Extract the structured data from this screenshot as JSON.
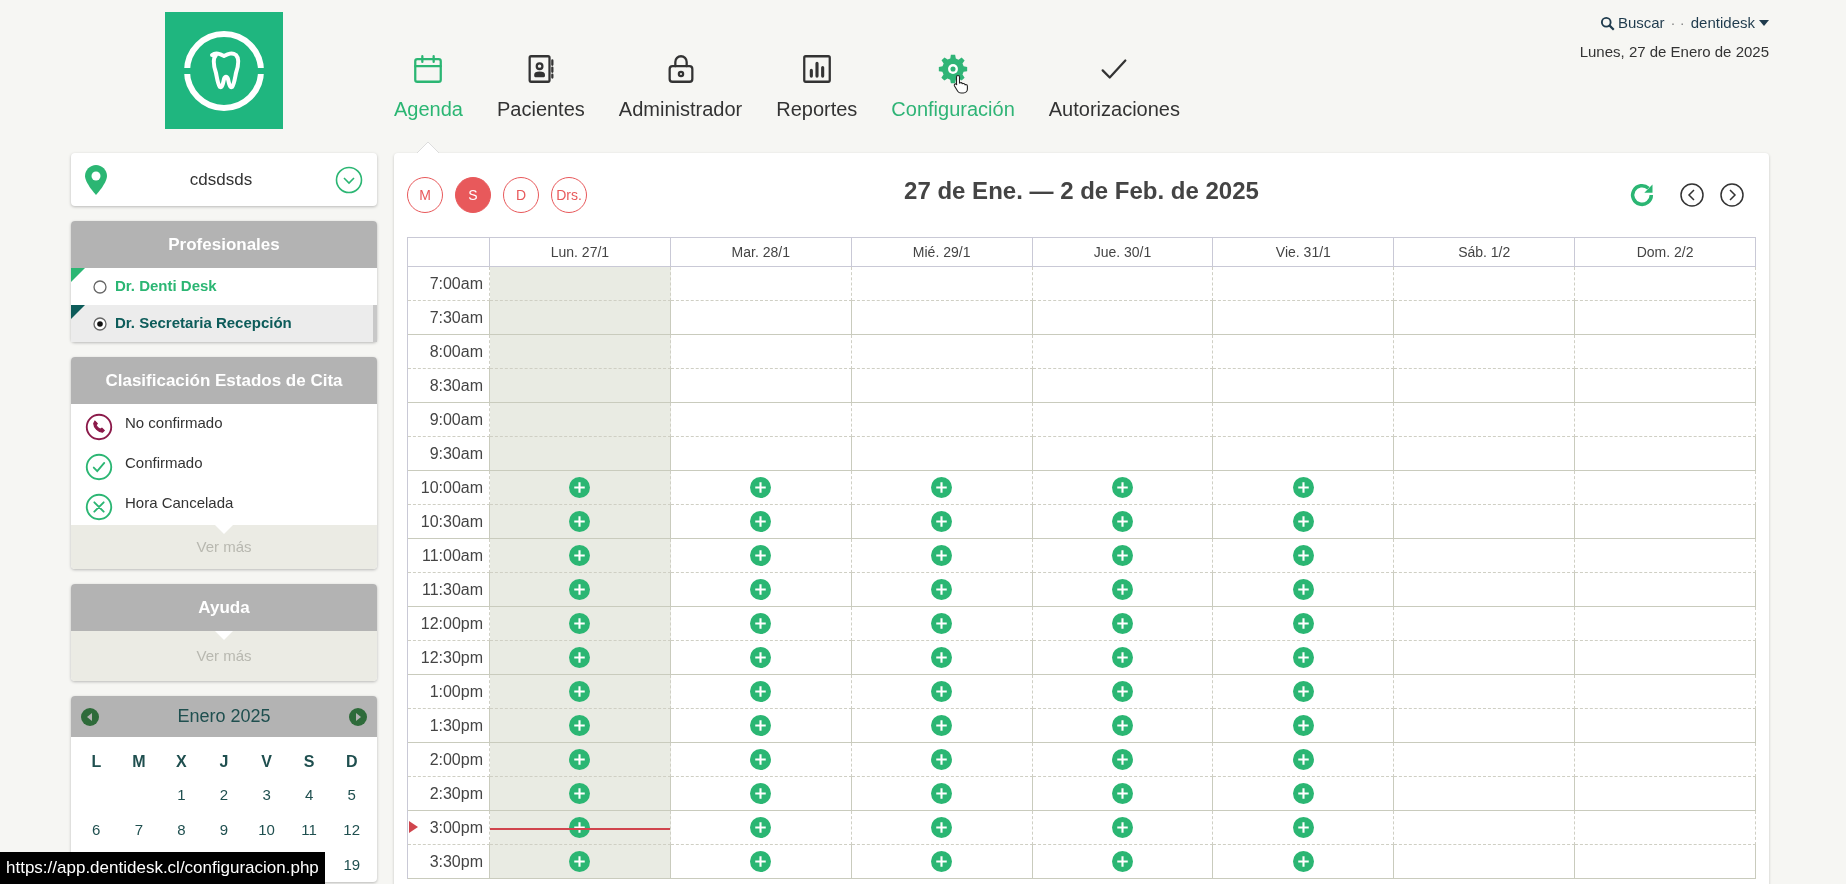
{
  "header": {
    "search_label": "Buscar",
    "separator": "· ·",
    "user_label": "dentidesk",
    "date": "Lunes, 27 de Enero de 2025"
  },
  "nav": [
    {
      "kind": "calendar",
      "label": "Agenda",
      "selected": true,
      "hovered": false
    },
    {
      "kind": "contacts",
      "label": "Pacientes",
      "selected": false,
      "hovered": false
    },
    {
      "kind": "lock",
      "label": "Administrador",
      "selected": false,
      "hovered": false
    },
    {
      "kind": "chart",
      "label": "Reportes",
      "selected": false,
      "hovered": false
    },
    {
      "kind": "gear",
      "label": "Configuración",
      "selected": false,
      "hovered": true
    },
    {
      "kind": "check",
      "label": "Autorizaciones",
      "selected": false,
      "hovered": false
    }
  ],
  "location": {
    "value": "cdsdsds"
  },
  "professionals": {
    "title": "Profesionales",
    "items": [
      {
        "name": "Dr. Denti Desk",
        "selected": false,
        "color": "#2bb673"
      },
      {
        "name": "Dr. Secretaria Recepción",
        "selected": true,
        "color": "#0d5c5a"
      }
    ]
  },
  "status_legend": {
    "title": "Clasificación Estados de Cita",
    "items": [
      {
        "kind": "phone",
        "label": "No confirmado"
      },
      {
        "kind": "check",
        "label": "Confirmado"
      },
      {
        "kind": "cancel",
        "label": "Hora Cancelada"
      }
    ],
    "more": "Ver más"
  },
  "help": {
    "title": "Ayuda",
    "more": "Ver más"
  },
  "mini_calendar": {
    "title": "Enero 2025",
    "weekdays": [
      "L",
      "M",
      "X",
      "J",
      "V",
      "S",
      "D"
    ],
    "weeks": [
      {
        "kind": "tail",
        "days": [
          "1",
          "2",
          "3",
          "4",
          "5"
        ]
      },
      {
        "kind": "full",
        "days": [
          "6",
          "7",
          "8",
          "9",
          "10",
          "11",
          "12"
        ]
      },
      {
        "kind": "tail",
        "days": [
          "19"
        ]
      }
    ]
  },
  "agenda": {
    "views": [
      {
        "label": "M",
        "selected": false
      },
      {
        "label": "S",
        "selected": true
      },
      {
        "label": "D",
        "selected": false
      },
      {
        "label": "Drs.",
        "selected": false
      }
    ],
    "title": "27 de Ene. — 2 de Feb. de 2025",
    "days": [
      {
        "label": "Lun. 27/1",
        "shaded": true
      },
      {
        "label": "Mar. 28/1",
        "shaded": false
      },
      {
        "label": "Mié. 29/1",
        "shaded": false
      },
      {
        "label": "Jue. 30/1",
        "shaded": false
      },
      {
        "label": "Vie. 31/1",
        "shaded": false
      },
      {
        "label": "Sáb. 1/2",
        "shaded": false
      },
      {
        "label": "Dom. 2/2",
        "shaded": false
      }
    ],
    "rows": [
      {
        "time": "7:00am",
        "add": [
          false,
          false,
          false,
          false,
          false,
          false,
          false
        ],
        "now": false
      },
      {
        "time": "7:30am",
        "add": [
          false,
          false,
          false,
          false,
          false,
          false,
          false
        ],
        "now": false
      },
      {
        "time": "8:00am",
        "add": [
          false,
          false,
          false,
          false,
          false,
          false,
          false
        ],
        "now": false
      },
      {
        "time": "8:30am",
        "add": [
          false,
          false,
          false,
          false,
          false,
          false,
          false
        ],
        "now": false
      },
      {
        "time": "9:00am",
        "add": [
          false,
          false,
          false,
          false,
          false,
          false,
          false
        ],
        "now": false
      },
      {
        "time": "9:30am",
        "add": [
          false,
          false,
          false,
          false,
          false,
          false,
          false
        ],
        "now": false
      },
      {
        "time": "10:00am",
        "add": [
          true,
          true,
          true,
          true,
          true,
          false,
          false
        ],
        "now": false
      },
      {
        "time": "10:30am",
        "add": [
          true,
          true,
          true,
          true,
          true,
          false,
          false
        ],
        "now": false
      },
      {
        "time": "11:00am",
        "add": [
          true,
          true,
          true,
          true,
          true,
          false,
          false
        ],
        "now": false
      },
      {
        "time": "11:30am",
        "add": [
          true,
          true,
          true,
          true,
          true,
          false,
          false
        ],
        "now": false
      },
      {
        "time": "12:00pm",
        "add": [
          true,
          true,
          true,
          true,
          true,
          false,
          false
        ],
        "now": false
      },
      {
        "time": "12:30pm",
        "add": [
          true,
          true,
          true,
          true,
          true,
          false,
          false
        ],
        "now": false
      },
      {
        "time": "1:00pm",
        "add": [
          true,
          true,
          true,
          true,
          true,
          false,
          false
        ],
        "now": false
      },
      {
        "time": "1:30pm",
        "add": [
          true,
          true,
          true,
          true,
          true,
          false,
          false
        ],
        "now": false
      },
      {
        "time": "2:00pm",
        "add": [
          true,
          true,
          true,
          true,
          true,
          false,
          false
        ],
        "now": false
      },
      {
        "time": "2:30pm",
        "add": [
          true,
          true,
          true,
          true,
          true,
          false,
          false
        ],
        "now": false
      },
      {
        "time": "3:00pm",
        "add": [
          true,
          true,
          true,
          true,
          true,
          false,
          false
        ],
        "now": true
      },
      {
        "time": "3:30pm",
        "add": [
          true,
          true,
          true,
          true,
          true,
          false,
          false
        ],
        "now": false
      }
    ]
  },
  "status_bar": {
    "url": "https://app.dentidesk.cl/configuracion.php"
  }
}
